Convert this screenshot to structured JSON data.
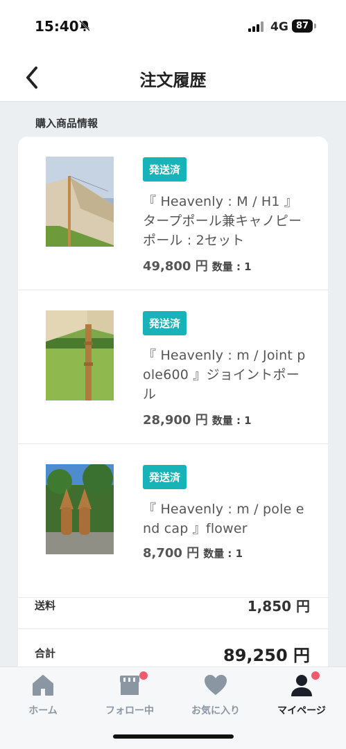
{
  "status": {
    "time": "15:40",
    "network": "4G",
    "battery": "87"
  },
  "header": {
    "title": "注文履歴"
  },
  "section": {
    "label": "購入商品情報"
  },
  "items": [
    {
      "badge": "発送済",
      "name": "『 Heavenly : M / H1 』タープポール兼キャノピーポール : 2セット",
      "price": "49,800 円",
      "qty": "数量 : 1"
    },
    {
      "badge": "発送済",
      "name": "『 Heavenly : m / Joint pole600 』ジョイントポール",
      "price": "28,900 円",
      "qty": "数量 : 1"
    },
    {
      "badge": "発送済",
      "name": "『 Heavenly : m / pole end cap 』flower",
      "price": "8,700 円",
      "qty": "数量 : 1"
    }
  ],
  "summary": {
    "shipping_label": "送料",
    "shipping_value": "1,850 円",
    "total_label": "合計",
    "total_value": "89,250 円"
  },
  "tabs": [
    {
      "label": "ホーム",
      "icon": "home-icon"
    },
    {
      "label": "フォロー中",
      "icon": "store-icon"
    },
    {
      "label": "お気に入り",
      "icon": "heart-icon"
    },
    {
      "label": "マイページ",
      "icon": "person-icon"
    }
  ],
  "colors": {
    "badge": "#17b3b8",
    "notification_dot": "#f05a6e",
    "tab_inactive": "#8a97a3"
  }
}
